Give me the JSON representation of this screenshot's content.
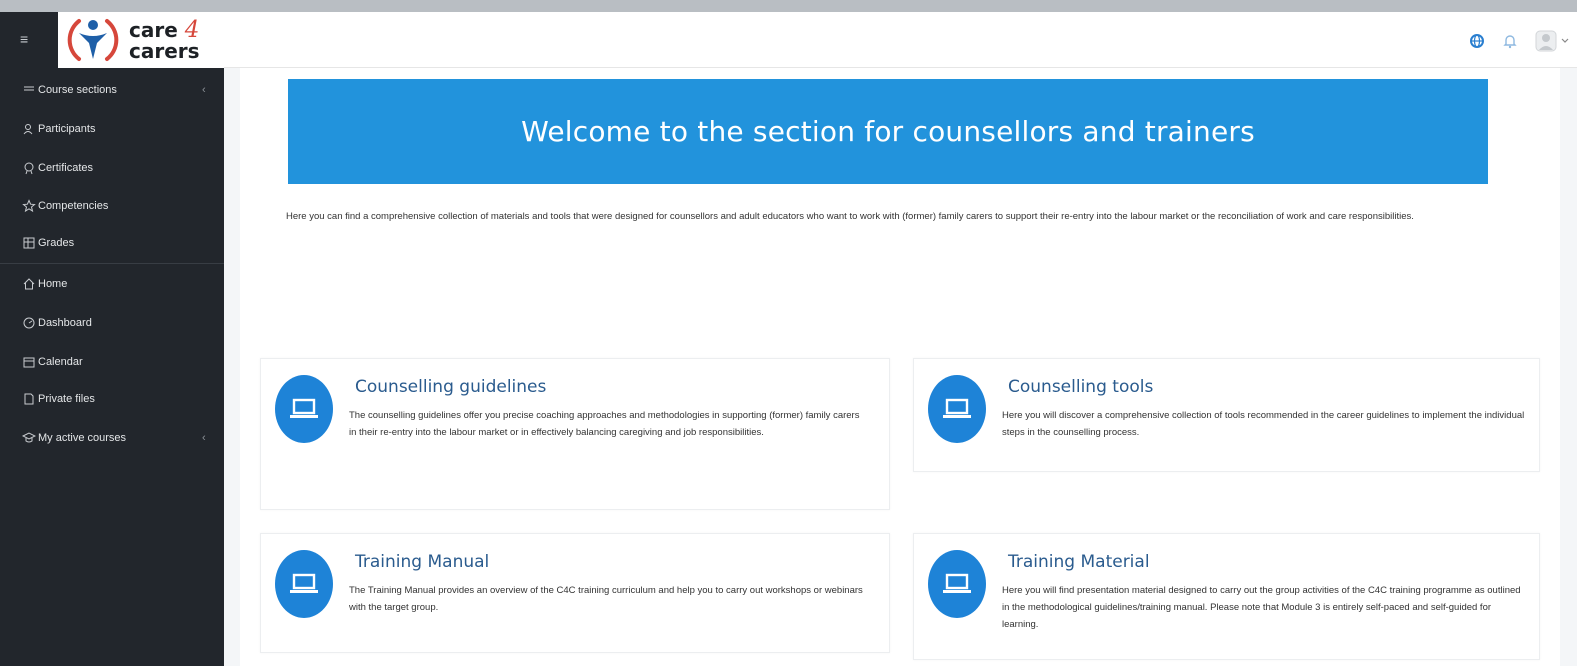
{
  "app": {
    "brand_line1": "care",
    "brand_four": "4",
    "brand_line2": "carers"
  },
  "sidebar": {
    "items": [
      {
        "label": "Course sections",
        "icon": "list-icon",
        "has_chevron": true
      },
      {
        "label": "Participants",
        "icon": "users-icon"
      },
      {
        "label": "Certificates",
        "icon": "certificate-icon"
      },
      {
        "label": "Competencies",
        "icon": "star-icon"
      },
      {
        "label": "Grades",
        "icon": "grades-icon"
      },
      {
        "label": "Home",
        "icon": "home-icon"
      },
      {
        "label": "Dashboard",
        "icon": "dashboard-icon"
      },
      {
        "label": "Calendar",
        "icon": "calendar-icon"
      },
      {
        "label": "Private files",
        "icon": "file-icon"
      },
      {
        "label": "My active courses",
        "icon": "courses-icon",
        "has_chevron": true
      }
    ],
    "chevron": "‹"
  },
  "banner": {
    "title": "Welcome to the section for counsellors and trainers"
  },
  "intro": {
    "text": "Here you can find a comprehensive collection of materials and tools that were designed for counsellors and adult educators who want to work with (former) family carers to support their re-entry into the labour market or the reconciliation of work and care responsibilities."
  },
  "cards": [
    {
      "title": "Counselling guidelines",
      "icon": "laptop-icon",
      "text": "The counselling guidelines offer you precise coaching approaches and methodologies in supporting (former) family carers in their re-entry into the labour market or in effectively balancing caregiving and job responsibilities."
    },
    {
      "title": "Counselling tools",
      "icon": "laptop-icon",
      "text": "Here you will discover a comprehensive collection of tools recommended in the career guidelines to implement the individual steps in the counselling process."
    },
    {
      "title": "Training Manual",
      "icon": "laptop-icon",
      "text": "The Training Manual provides an overview of the C4C training curriculum and help you to carry out workshops or webinars with the target group."
    },
    {
      "title": "Training Material",
      "icon": "laptop-icon",
      "text": "Here you will find presentation material designed to carry out the group activities of the C4C training programme as outlined in the methodological guidelines/training manual. Please note that Module 3 is entirely self-paced and self-guided for learning."
    }
  ],
  "colors": {
    "sidebar_bg": "#22262c",
    "banner_bg": "#2293dc",
    "accent": "#1e83d7",
    "card_title": "#2a5b8e"
  }
}
